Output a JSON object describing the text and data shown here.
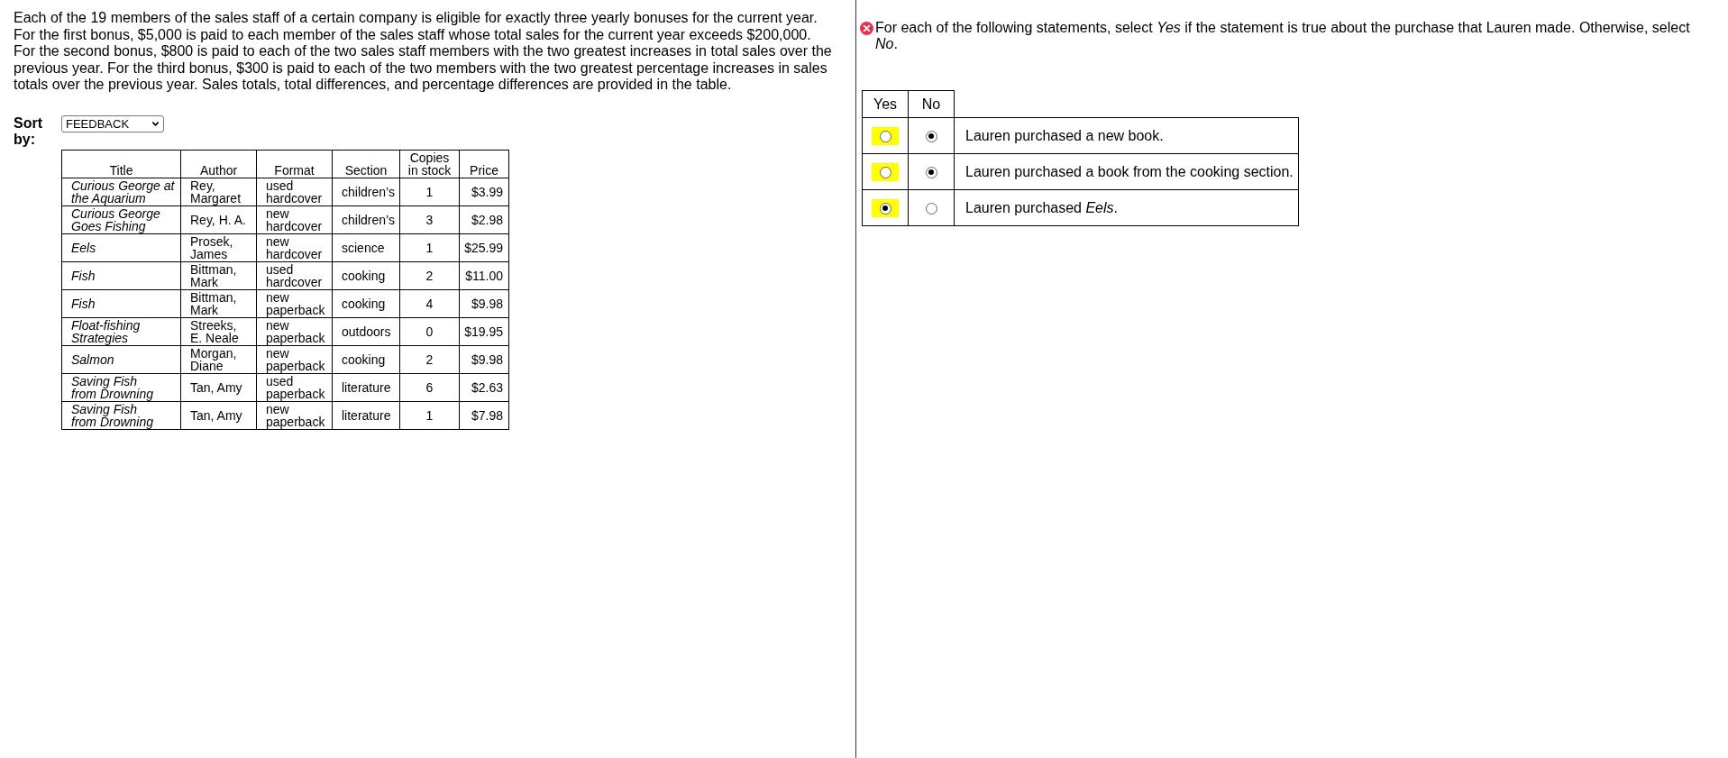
{
  "problem": {
    "text": "Each of the 19 members of the sales staff of a certain company is eligible for exactly three yearly bonuses for the current year. For the first bonus, $5,000 is paid to each member of the sales staff whose total sales for the current year exceeds $200,000. For the second bonus, $800 is paid to each of the two sales staff members with the two greatest increases in total sales over the previous year. For the third bonus, $300 is paid to each of the two members with the two greatest percentage increases in sales totals over the previous year. Sales totals, total differences, and percentage differences are provided in the table."
  },
  "sort": {
    "label": "Sort by:",
    "value": "FEEDBACK"
  },
  "books_table": {
    "columns": [
      "Title",
      "Author",
      "Format",
      "Section",
      "Copies in stock",
      "Price"
    ],
    "rows": [
      [
        "Curious George at the Aquarium",
        "Rey, Margaret",
        "used hardcover",
        "children’s",
        "1",
        "$3.99"
      ],
      [
        "Curious George Goes Fishing",
        "Rey, H. A.",
        "new hardcover",
        "children’s",
        "3",
        "$2.98"
      ],
      [
        "Eels",
        "Prosek, James",
        "new hardcover",
        "science",
        "1",
        "$25.99"
      ],
      [
        "Fish",
        "Bittman, Mark",
        "used hardcover",
        "cooking",
        "2",
        "$11.00"
      ],
      [
        "Fish",
        "Bittman, Mark",
        "new paperback",
        "cooking",
        "4",
        "$9.98"
      ],
      [
        "Float-fishing Strategies",
        "Streeks, E. Neale",
        "new paperback",
        "outdoors",
        "0",
        "$19.95"
      ],
      [
        "Salmon",
        "Morgan, Diane",
        "new paperback",
        "cooking",
        "2",
        "$9.98"
      ],
      [
        "Saving Fish\nfrom Drowning",
        "Tan, Amy",
        "used paperback",
        "literature",
        "6",
        "$2.63"
      ],
      [
        "Saving Fish\nfrom Drowning",
        "Tan, Amy",
        "new paperback",
        "literature",
        "1",
        "$7.98"
      ]
    ]
  },
  "question": {
    "marked_incorrect": true,
    "prompt": "For each of the following statements, select *Yes* if the statement is true about the purchase that Lauren made. Otherwise, select *No*.",
    "columns": [
      {
        "label": "Yes",
        "highlighted": true
      },
      {
        "label": "No",
        "highlighted": false
      }
    ],
    "rows": [
      {
        "statement": "Lauren purchased a new book.",
        "choices": [
          {
            "selected": false
          },
          {
            "selected": true
          }
        ]
      },
      {
        "statement": "Lauren purchased a book from the cooking section.",
        "choices": [
          {
            "selected": false
          },
          {
            "selected": true
          }
        ]
      },
      {
        "statement": "Lauren purchased *Eels*.",
        "choices": [
          {
            "selected": true
          },
          {
            "selected": false
          }
        ]
      }
    ]
  }
}
